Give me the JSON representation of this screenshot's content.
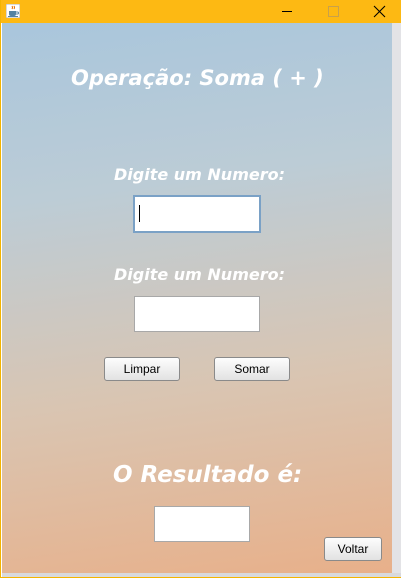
{
  "window": {
    "icon": "java-cup-icon",
    "controls": {
      "minimize": "minimize-icon",
      "maximize": "maximize-icon",
      "close": "close-icon"
    }
  },
  "form": {
    "title": "Operação: Soma ( + )",
    "label_number_1": "Digite um Numero:",
    "label_number_2": "Digite um Numero:",
    "input_number_1": "",
    "input_number_2": "",
    "clear_button": "Limpar",
    "sum_button": "Somar",
    "result_label": "O Resultado é:",
    "result_value": "",
    "back_button": "Voltar"
  },
  "colors": {
    "titlebar": "#fdb913",
    "gradient_top": "#a9c6dc",
    "gradient_bottom": "#e8b08a",
    "label_text": "#ffffff"
  }
}
